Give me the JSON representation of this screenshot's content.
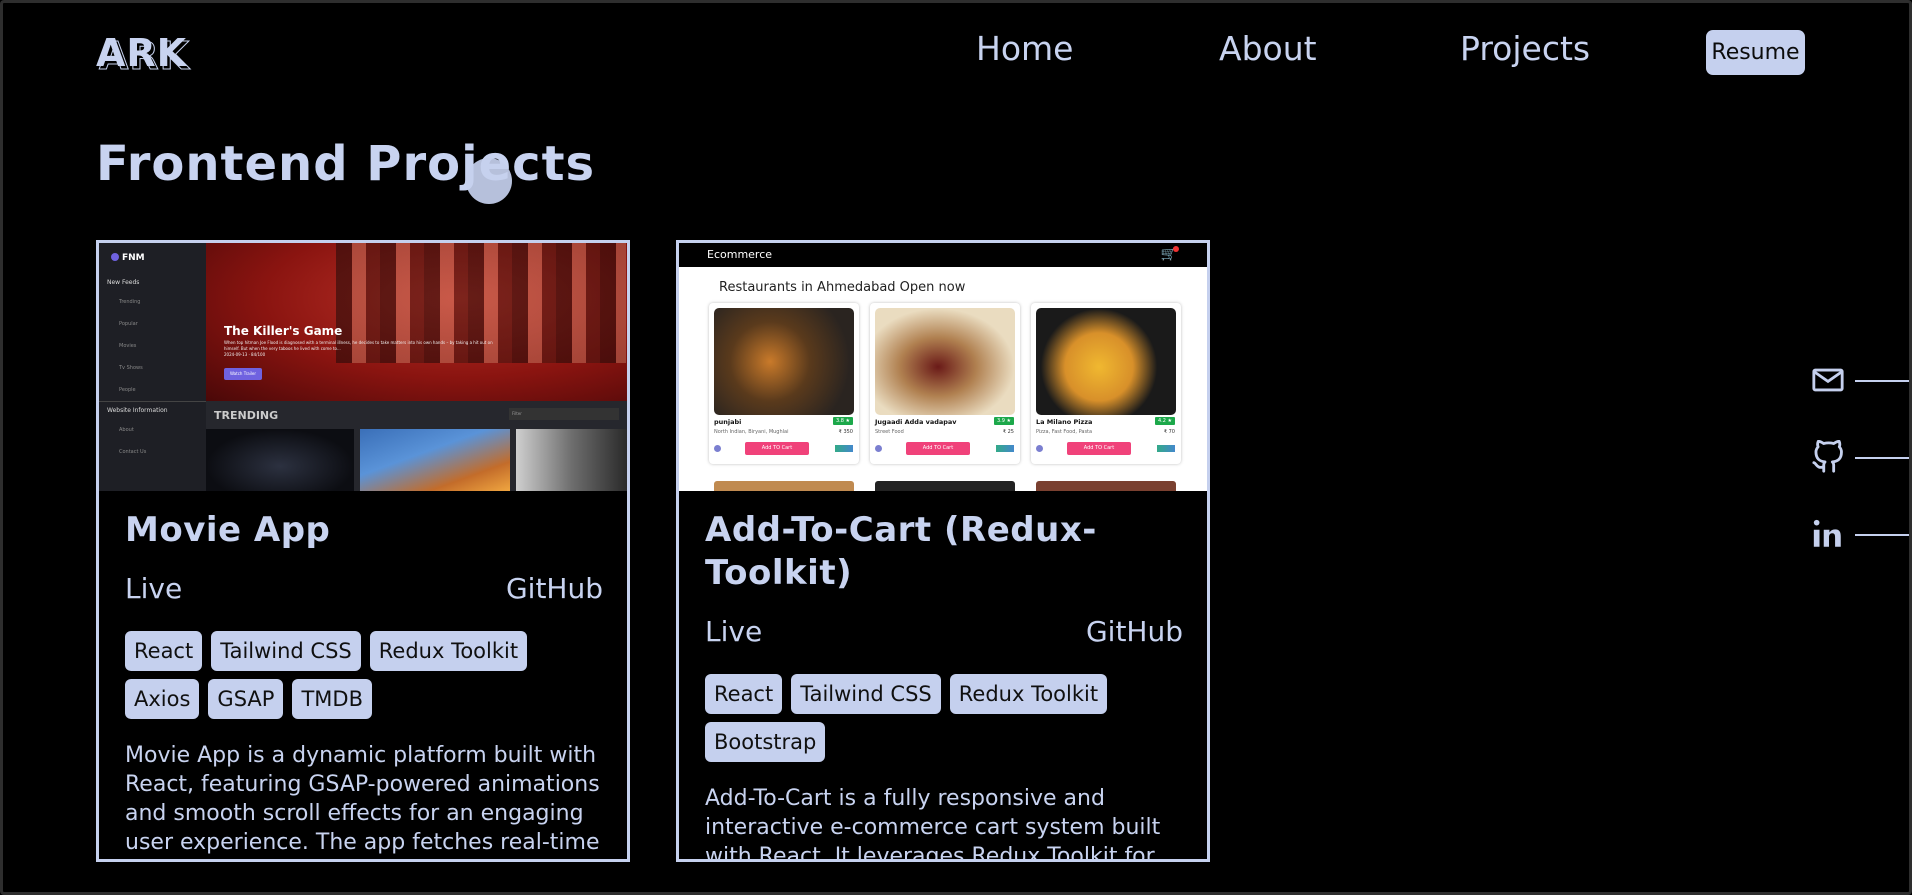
{
  "header": {
    "logo": "ARK",
    "nav": [
      "Home",
      "About",
      "Projects"
    ],
    "resume_label": "Resume"
  },
  "section": {
    "title": "Frontend Projects"
  },
  "projects": [
    {
      "title": "Movie App",
      "live_label": "Live",
      "github_label": "GitHub",
      "tags": [
        "React",
        "Tailwind CSS",
        "Redux Toolkit",
        "Axios",
        "GSAP",
        "TMDB"
      ],
      "description": "Movie App is a dynamic platform built with React, featuring GSAP-powered animations and smooth scroll effects for an engaging user experience. The app fetches real-time",
      "preview": {
        "brand": "FNM",
        "feeds_label": "New Feeds",
        "feed_items": [
          "Trending",
          "Popular",
          "Movies",
          "Tv Shows",
          "People"
        ],
        "info_label": "Website Information",
        "info_items": [
          "About",
          "Contact Us"
        ],
        "hero_title": "The Killer's Game",
        "hero_text": "When top hitman Joe Flood is diagnosed with a terminal illness, he decides to take matters into his own hands – by taking a hit out on himself. But when the very taboos he lived with come to...",
        "hero_meta": "2024-09-13  ·  84/100",
        "hero_button": "Watch Trailer",
        "trending_label": "TRENDING",
        "filter_label": "Filter"
      }
    },
    {
      "title": "Add-To-Cart (Redux-Toolkit)",
      "live_label": "Live",
      "github_label": "GitHub",
      "tags": [
        "React",
        "Tailwind CSS",
        "Redux Toolkit",
        "Bootstrap"
      ],
      "description": "Add-To-Cart is a fully responsive and interactive e-commerce cart system built with React. It leverages Redux Toolkit for",
      "preview": {
        "brand": "Ecommerce",
        "heading": "Restaurants in Ahmedabad Open now",
        "items": [
          {
            "name": "punjabi",
            "rating": "3.8 ★",
            "cuisine": "North Indian, Biryani, Mughlai",
            "price": "₹ 350",
            "button": "Add TO Cart"
          },
          {
            "name": "Jugaadi Adda vadapav",
            "rating": "3.9 ★",
            "cuisine": "Street Food",
            "price": "₹ 25",
            "button": "Add TO Cart"
          },
          {
            "name": "La Milano Pizza",
            "rating": "4.2 ★",
            "cuisine": "Pizza, Fast Food, Pasta",
            "price": "₹ 70",
            "button": "Add TO Cart"
          }
        ]
      }
    }
  ],
  "social": [
    "mail-icon",
    "github-icon",
    "linkedin-icon"
  ],
  "colors": {
    "accent": "#c5d0ee",
    "background": "#000000"
  }
}
